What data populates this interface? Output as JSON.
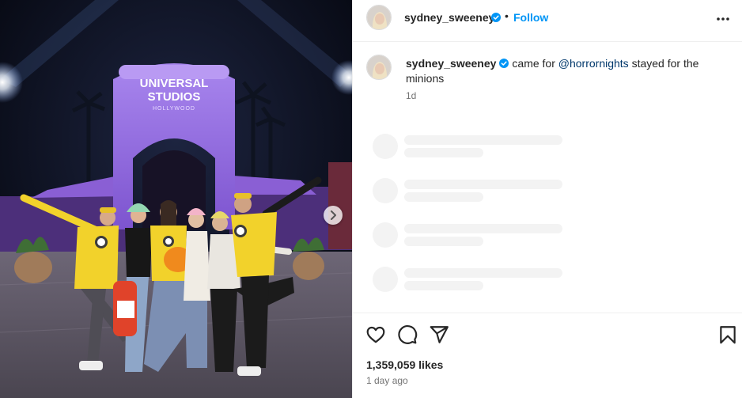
{
  "post": {
    "username": "sydney_sweeney",
    "follow_label": "Follow",
    "separator": "•",
    "caption": {
      "username": "sydney_sweeney",
      "text_before": "came for ",
      "mention": "@horrornights",
      "text_after": " stayed for the minions",
      "relative_time": "1d"
    },
    "likes": "1,359,059 likes",
    "timestamp": "1 day ago"
  },
  "photo": {
    "sign_line1": "UNIVERSAL",
    "sign_line2": "STUDIOS",
    "sign_line3": "HOLLYWOOD"
  },
  "icons": {
    "verified": "verified-badge-icon",
    "more": "more-options-icon",
    "like": "heart-icon",
    "comment": "comment-icon",
    "share": "send-icon",
    "save": "bookmark-icon",
    "next": "chevron-right-icon"
  },
  "colors": {
    "accent": "#0095f6",
    "mention": "#00376b",
    "muted": "#737373",
    "skeleton": "#f3f3f3",
    "arch_purple": "#9b6fe0",
    "minion_yellow": "#f2d22b"
  }
}
